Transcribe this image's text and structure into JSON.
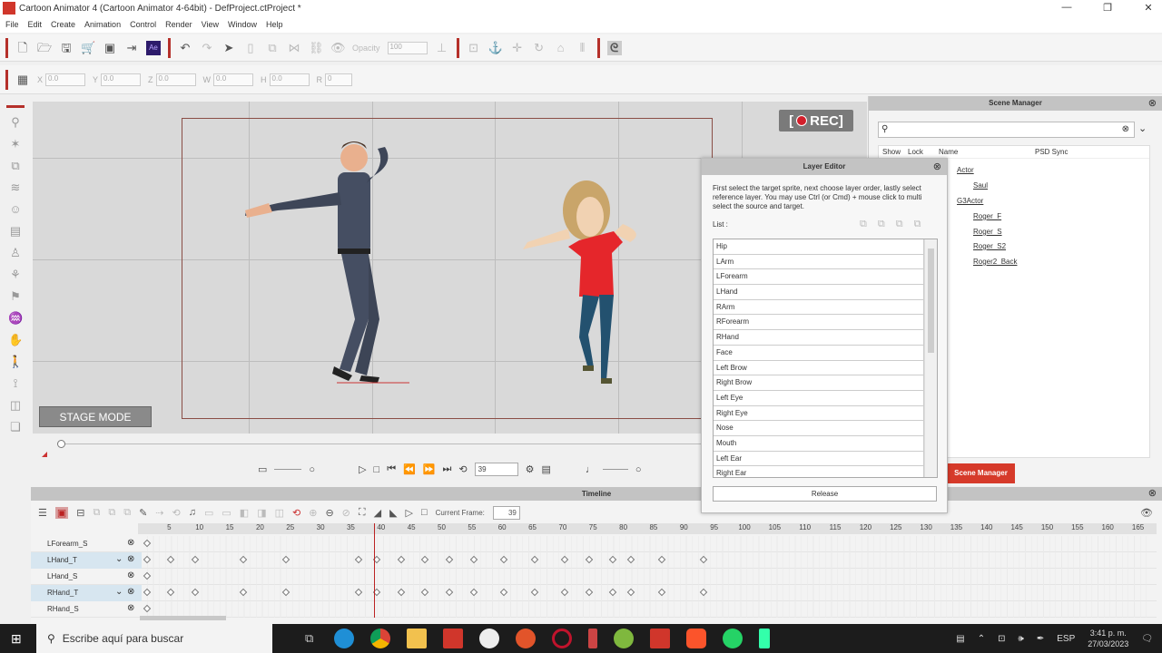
{
  "window": {
    "title": "Cartoon Animator 4  (Cartoon Animator 4-64bit) - DefProject.ctProject *"
  },
  "menu": [
    "File",
    "Edit",
    "Create",
    "Animation",
    "Control",
    "Render",
    "View",
    "Window",
    "Help"
  ],
  "toolbar": {
    "opacity_label": "Opacity",
    "opacity_value": "100"
  },
  "transform": {
    "x_label": "X",
    "x": "0.0",
    "y_label": "Y",
    "y": "0.0",
    "z_label": "Z",
    "z": "0.0",
    "w_label": "W",
    "w": "0.0",
    "h_label": "H",
    "h": "0.0",
    "r_label": "R",
    "r": "0"
  },
  "stage": {
    "rec_label": "REC",
    "stage_mode_label": "STAGE MODE"
  },
  "playback": {
    "frame": "39"
  },
  "scene_manager": {
    "title": "Scene Manager",
    "columns": [
      "Show",
      "Lock",
      "Name",
      "PSD Sync"
    ],
    "tree": [
      {
        "label": "Actor",
        "level": 0
      },
      {
        "label": "Saul",
        "level": 1
      },
      {
        "label": "G3Actor",
        "level": 0
      },
      {
        "label": "Roger_F",
        "level": 1
      },
      {
        "label": "Roger_S",
        "level": 1
      },
      {
        "label": "Roger_S2",
        "level": 1
      },
      {
        "label": "Roger2_Back",
        "level": 1
      }
    ],
    "button": "Scene Manager"
  },
  "layer_editor": {
    "title": "Layer Editor",
    "description": "First select the target sprite, next choose layer order, lastly select reference layer. You may use Ctrl (or Cmd) + mouse click to multi select the source and target.",
    "list_label": "List :",
    "items": [
      "Hip",
      "LArm",
      "LForearm",
      "LHand",
      "RArm",
      "RForearm",
      "RHand",
      "Face",
      "Left Brow",
      "Right Brow",
      "Left Eye",
      "Right Eye",
      "Nose",
      "Mouth",
      "Left Ear",
      "Right Ear"
    ],
    "release": "Release"
  },
  "timeline": {
    "title": "Timeline",
    "current_frame_label": "Current Frame:",
    "current_frame": "39",
    "tracks": [
      {
        "name": "LForearm_S",
        "selected": false,
        "keys": [
          1
        ]
      },
      {
        "name": "LHand_T",
        "selected": true,
        "keys": [
          1,
          5,
          9,
          17,
          24,
          36,
          39,
          43,
          47,
          51,
          55,
          60,
          65,
          70,
          74,
          78,
          81,
          86,
          93
        ]
      },
      {
        "name": "LHand_S",
        "selected": false,
        "keys": [
          1
        ]
      },
      {
        "name": "RHand_T",
        "selected": true,
        "keys": [
          1,
          5,
          9,
          17,
          24,
          36,
          39,
          43,
          47,
          51,
          55,
          60,
          65,
          70,
          74,
          78,
          81,
          86,
          93
        ]
      },
      {
        "name": "RHand_S",
        "selected": false,
        "keys": [
          1
        ]
      }
    ]
  },
  "taskbar": {
    "search": "Escribe aquí para buscar",
    "lang": "ESP",
    "time": "3:41 p. m.",
    "date": "27/03/2023"
  }
}
